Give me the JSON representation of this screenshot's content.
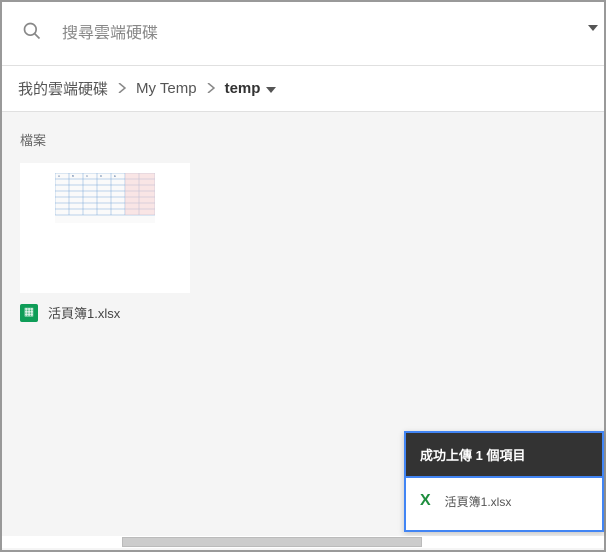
{
  "search": {
    "placeholder": "搜尋雲端硬碟"
  },
  "breadcrumb": {
    "items": [
      "我的雲端硬碟",
      "My Temp"
    ],
    "current": "temp"
  },
  "section": {
    "label": "檔案"
  },
  "files": [
    {
      "name": "活頁簿1.xlsx"
    }
  ],
  "toast": {
    "title": "成功上傳 1 個項目",
    "items": [
      {
        "name": "活頁簿1.xlsx"
      }
    ]
  }
}
